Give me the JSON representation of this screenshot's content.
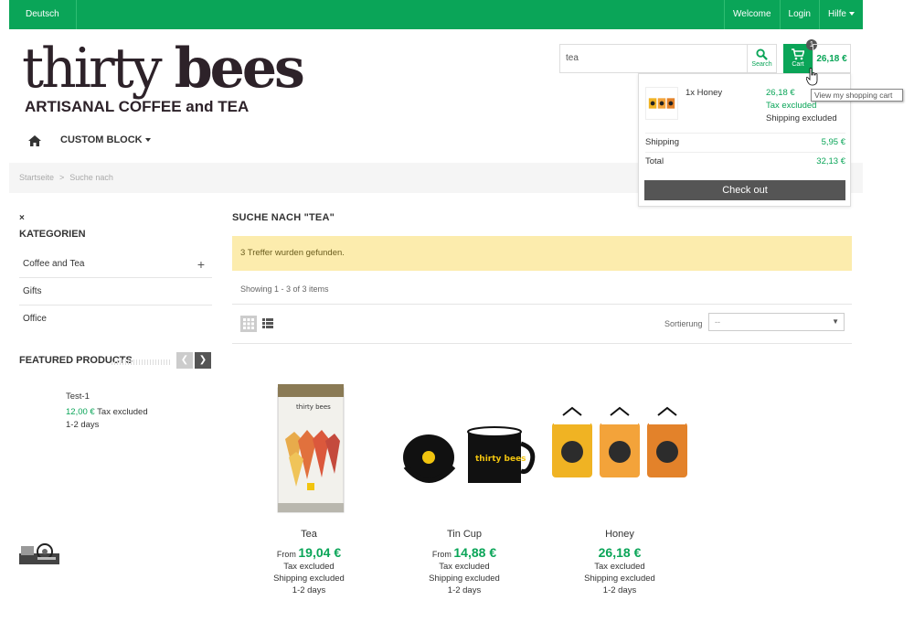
{
  "topbar": {
    "language": "Deutsch",
    "welcome": "Welcome",
    "login": "Login",
    "help": "Hilfe"
  },
  "logo": {
    "main_thin": "thirty ",
    "main_bold": "bees",
    "tagline": "ARTISANAL COFFEE and TEA"
  },
  "search": {
    "value": "tea",
    "button_label": "Search"
  },
  "cart": {
    "label": "Cart",
    "count": "1",
    "total": "26,18 €",
    "tooltip": "View my shopping cart",
    "dropdown": {
      "qty_name": "1x  Honey",
      "price": "26,18 €",
      "tax": "Tax excluded",
      "shipping_note": "Shipping excluded",
      "shipping_label": "Shipping",
      "shipping_value": "5,95 €",
      "total_label": "Total",
      "total_value": "32,13 €",
      "checkout": "Check out"
    }
  },
  "nav": {
    "custom_block": "CUSTOM BLOCK"
  },
  "breadcrumb": {
    "home": "Startseite",
    "sep": ">",
    "current": "Suche nach"
  },
  "sidebar": {
    "close": "×",
    "categories_title": "KATEGORIEN",
    "categories": [
      {
        "label": "Coffee and Tea",
        "expand": "+"
      },
      {
        "label": "Gifts"
      },
      {
        "label": "Office"
      }
    ],
    "featured_title": "FEATURED PRODUCTS",
    "featured_product": {
      "name": "Test-1",
      "price": "12,00 €",
      "tax": " Tax excluded",
      "days": "1-2 days"
    }
  },
  "main": {
    "title": "SUCHE NACH  \"TEA\"",
    "alert": "3 Treffer wurden gefunden.",
    "showing": "Showing 1 - 3 of 3 items",
    "sort_label": "Sortierung",
    "sort_value": "--",
    "products": [
      {
        "name": "Tea",
        "from": "From ",
        "price": "19,04 €",
        "tax": "Tax excluded",
        "shipping": "Shipping excluded",
        "days": "1-2 days"
      },
      {
        "name": "Tin Cup",
        "from": "From ",
        "price": "14,88 €",
        "tax": "Tax excluded",
        "shipping": "Shipping excluded",
        "days": "1-2 days"
      },
      {
        "name": "Honey",
        "from": "",
        "price": "26,18 €",
        "tax": "Tax excluded",
        "shipping": "Shipping excluded",
        "days": "1-2 days"
      }
    ]
  },
  "colors": {
    "brand_green": "#0aa558",
    "alert_bg": "#fcecad",
    "dark_button": "#555555"
  }
}
